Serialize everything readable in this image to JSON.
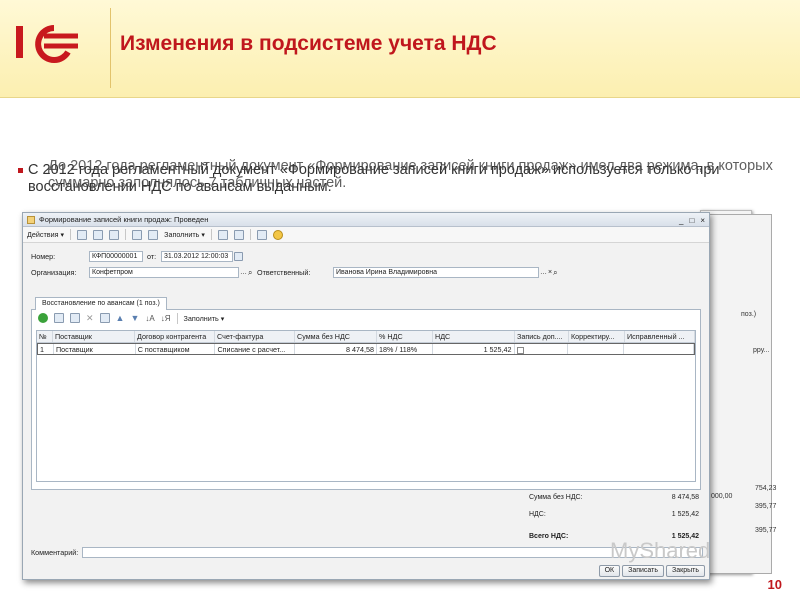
{
  "slide": {
    "title": "Изменения в подсистеме учета НДС",
    "text_back": "До 2012 года регламентный документ «Формирование записей книги продаж» имел два режима, в которых суммарно заполнялось 7 табличных частей.",
    "text_front": "С 2012 года регламентный документ «Формирование записей книги продаж» используется только при восстановлении НДС по авансам выданным.",
    "page_number": "10",
    "watermark": "MyShared"
  },
  "window": {
    "title": "Формирование записей книги продаж: Проведен",
    "toolbar": {
      "actions": "Действия",
      "fill": "Заполнить"
    },
    "fields": {
      "number_label": "Номер:",
      "number_value": "КФП00000001",
      "date_label": "от:",
      "date_value": "31.03.2012 12:00:03",
      "org_label": "Организация:",
      "org_value": "Конфетпром",
      "resp_label": "Ответственный:",
      "resp_value": "Иванова Ирина Владимировна"
    },
    "tab": "Восстановление по авансам (1 поз.)",
    "panel_fill": "Заполнить",
    "grid": {
      "headers": [
        "№",
        "Поставщик",
        "Договор контрагента",
        "Счет-фактура",
        "Сумма без НДС",
        "% НДС",
        "НДС",
        "Запись доп....",
        "Корректиру...",
        "Исправленный ..."
      ],
      "rows": [
        [
          "1",
          "Поставщик",
          "С поставщиком",
          "Списание с расчет...",
          "8 474,58",
          "18% / 118%",
          "1 525,42",
          "",
          "",
          ""
        ]
      ]
    },
    "totals": {
      "sum_label": "Сумма без НДС:",
      "sum_value": "8 474,58",
      "vat_label": "НДС:",
      "vat_value": "1 525,42",
      "total_label": "Всего НДС:",
      "total_value": "1 525,42"
    },
    "comment_label": "Комментарий:",
    "buttons": {
      "ok": "ОК",
      "save": "Записать",
      "close": "Закрыть"
    }
  },
  "side_window": {
    "values": [
      "754,23",
      "000,00",
      "395,77",
      "395,77"
    ],
    "tab": "поз.)",
    "col": "рру..."
  }
}
